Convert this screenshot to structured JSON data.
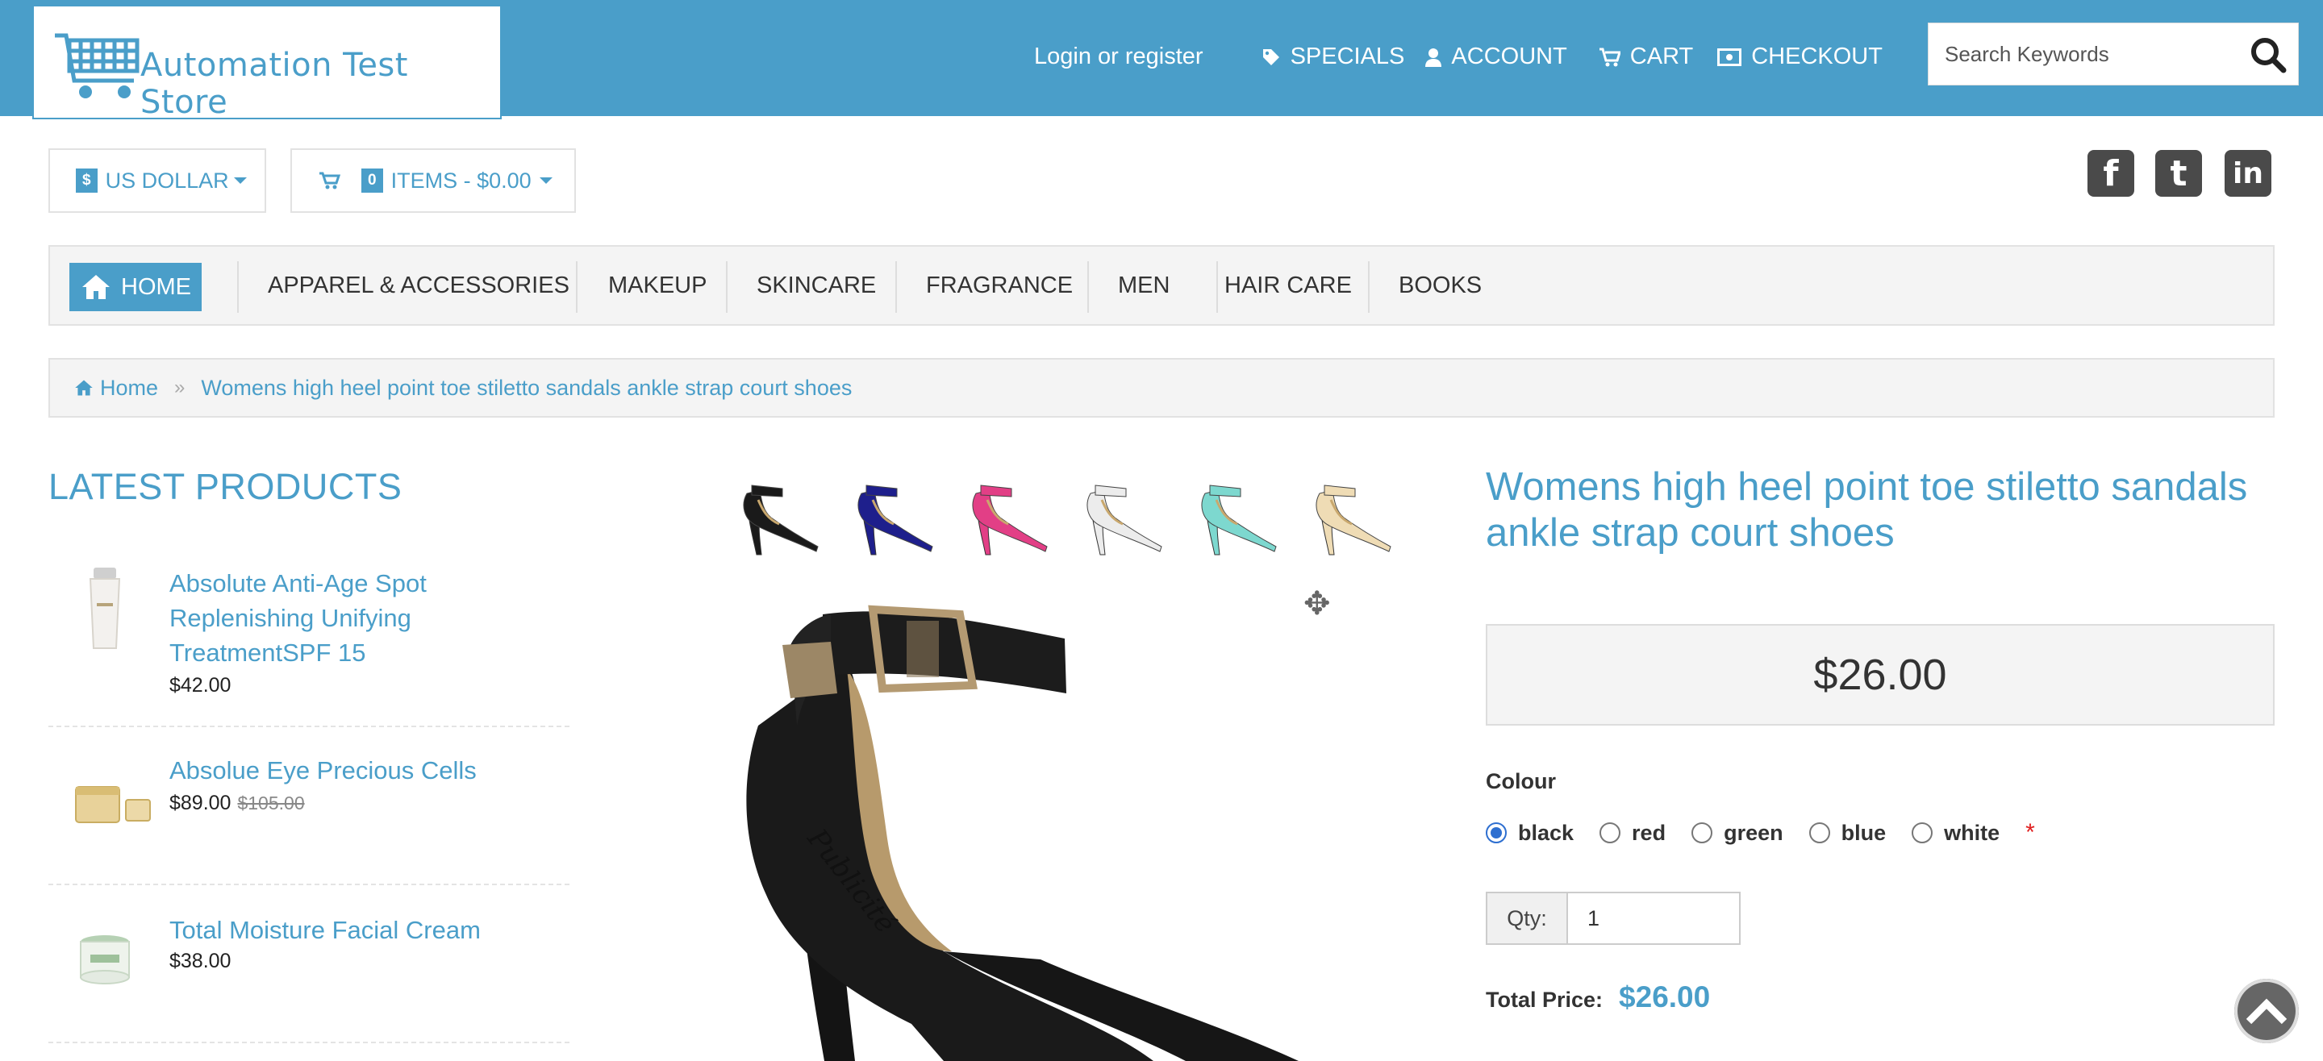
{
  "header": {
    "logo_text": "Automation Test Store",
    "login": "Login or register",
    "nav": [
      {
        "label": "SPECIALS",
        "icon": "tag-icon"
      },
      {
        "label": "ACCOUNT",
        "icon": "user-icon"
      },
      {
        "label": "CART",
        "icon": "cart-icon"
      },
      {
        "label": "CHECKOUT",
        "icon": "money-icon"
      }
    ],
    "search_placeholder": "Search Keywords"
  },
  "toolbar": {
    "currency_symbol": "$",
    "currency": "US DOLLAR",
    "cart_count": "0",
    "cart_summary": "ITEMS - $0.00"
  },
  "social": [
    "f",
    "t",
    "in"
  ],
  "categories": {
    "home": "HOME",
    "items": [
      "APPAREL & ACCESSORIES",
      "MAKEUP",
      "SKINCARE",
      "FRAGRANCE",
      "MEN",
      "HAIR CARE",
      "BOOKS"
    ]
  },
  "breadcrumb": {
    "home": "Home",
    "current": "Womens high heel point toe stiletto sandals ankle strap court shoes"
  },
  "latest": {
    "title": "LATEST PRODUCTS",
    "items": [
      {
        "name": "Absolute Anti-Age Spot Replenishing Unifying TreatmentSPF 15",
        "price": "$42.00",
        "old_price": ""
      },
      {
        "name": "Absolue Eye Precious Cells",
        "price": "$89.00",
        "old_price": "$105.00"
      },
      {
        "name": "Total Moisture Facial Cream",
        "price": "$38.00",
        "old_price": ""
      }
    ]
  },
  "product": {
    "title": "Womens high heel point toe stiletto sandals ankle strap court shoes",
    "price": "$26.00",
    "colour_label": "Colour",
    "colours": [
      "black",
      "red",
      "green",
      "blue",
      "white"
    ],
    "selected_colour": "black",
    "required_mark": "*",
    "qty_label": "Qty:",
    "qty_value": "1",
    "total_label": "Total Price:",
    "total_value": "$26.00",
    "thumb_colors": [
      "#1a1a1a",
      "#1e1f8c",
      "#e23f86",
      "#ececec",
      "#7dd8cf",
      "#efdcb5"
    ],
    "image_text": "Publicité"
  },
  "colors": {
    "brand": "#4a9ec9",
    "panel": "#f4f4f4"
  }
}
